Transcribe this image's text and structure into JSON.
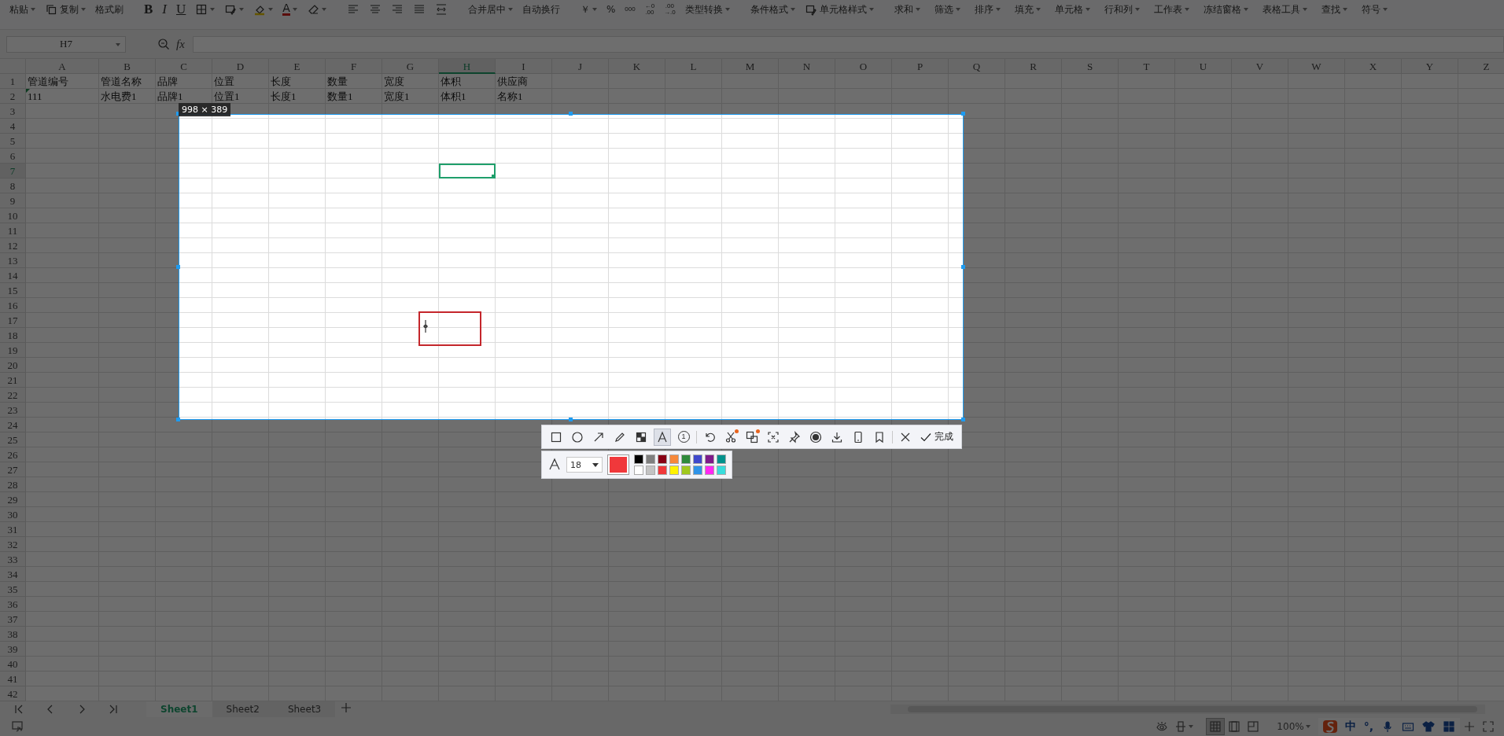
{
  "ribbon": {
    "clipboard": [
      {
        "label": "粘贴",
        "dropdown": true
      },
      {
        "label": "复制",
        "dropdown": true
      },
      {
        "label": "格式刷",
        "dropdown": false
      }
    ],
    "font_styles": [
      "B",
      "I",
      "U"
    ],
    "font_color": "A",
    "alignment": [
      {
        "label": "合并居中",
        "dropdown": true
      },
      {
        "label": "自动换行",
        "dropdown": false
      }
    ],
    "number": {
      "currency": "￥",
      "percent": "%",
      "thousands": "000",
      "decimal_increase": [
        "←0",
        ".00"
      ],
      "decimal_decrease": [
        ".00",
        "→.0"
      ],
      "type_convert": "类型转换"
    },
    "styles": [
      {
        "label": "条件格式",
        "dropdown": true
      },
      {
        "label": "单元格样式",
        "dropdown": true
      }
    ],
    "commands": [
      {
        "label": "求和",
        "dropdown": true
      },
      {
        "label": "筛选",
        "dropdown": true
      },
      {
        "label": "排序",
        "dropdown": true
      },
      {
        "label": "填充",
        "dropdown": true
      },
      {
        "label": "单元格",
        "dropdown": true
      },
      {
        "label": "行和列",
        "dropdown": true
      },
      {
        "label": "工作表",
        "dropdown": true
      },
      {
        "label": "冻结窗格",
        "dropdown": true
      },
      {
        "label": "表格工具",
        "dropdown": true
      },
      {
        "label": "查找",
        "dropdown": true
      },
      {
        "label": "符号",
        "dropdown": true
      }
    ]
  },
  "formula_bar": {
    "cell_reference": "H7",
    "function_label": "fx"
  },
  "sheet": {
    "columns": [
      {
        "label": "A",
        "selected": false
      },
      {
        "label": "B",
        "selected": false
      },
      {
        "label": "C",
        "selected": false
      },
      {
        "label": "D",
        "selected": false
      },
      {
        "label": "E",
        "selected": false
      },
      {
        "label": "F",
        "selected": false
      },
      {
        "label": "G",
        "selected": false
      },
      {
        "label": "H",
        "selected": true
      },
      {
        "label": "I",
        "selected": false
      },
      {
        "label": "J",
        "selected": false
      },
      {
        "label": "K",
        "selected": false
      },
      {
        "label": "L",
        "selected": false
      },
      {
        "label": "M",
        "selected": false
      },
      {
        "label": "N",
        "selected": false
      },
      {
        "label": "O",
        "selected": false
      },
      {
        "label": "P",
        "selected": false
      },
      {
        "label": "Q",
        "selected": false
      },
      {
        "label": "R",
        "selected": false
      },
      {
        "label": "S",
        "selected": false
      },
      {
        "label": "T",
        "selected": false
      },
      {
        "label": "U",
        "selected": false
      },
      {
        "label": "V",
        "selected": false
      },
      {
        "label": "W",
        "selected": false
      },
      {
        "label": "X",
        "selected": false
      },
      {
        "label": "Y",
        "selected": false
      },
      {
        "label": "Z",
        "selected": false
      }
    ],
    "rows": [
      {
        "label": "1",
        "selected": false
      },
      {
        "label": "2",
        "selected": false
      },
      {
        "label": "3",
        "selected": false
      },
      {
        "label": "4",
        "selected": false
      },
      {
        "label": "5",
        "selected": false
      },
      {
        "label": "6",
        "selected": false
      },
      {
        "label": "7",
        "selected": true
      },
      {
        "label": "8",
        "selected": false
      },
      {
        "label": "9",
        "selected": false
      },
      {
        "label": "10",
        "selected": false
      },
      {
        "label": "11",
        "selected": false
      },
      {
        "label": "12",
        "selected": false
      },
      {
        "label": "13",
        "selected": false
      },
      {
        "label": "14",
        "selected": false
      },
      {
        "label": "15",
        "selected": false
      },
      {
        "label": "16",
        "selected": false
      },
      {
        "label": "17",
        "selected": false
      },
      {
        "label": "18",
        "selected": false
      },
      {
        "label": "19",
        "selected": false
      },
      {
        "label": "20",
        "selected": false
      },
      {
        "label": "21",
        "selected": false
      },
      {
        "label": "22",
        "selected": false
      },
      {
        "label": "23",
        "selected": false
      },
      {
        "label": "24",
        "selected": false
      },
      {
        "label": "25",
        "selected": false
      },
      {
        "label": "26",
        "selected": false
      },
      {
        "label": "27",
        "selected": false
      },
      {
        "label": "28",
        "selected": false
      },
      {
        "label": "29",
        "selected": false
      },
      {
        "label": "30",
        "selected": false
      },
      {
        "label": "31",
        "selected": false
      },
      {
        "label": "32",
        "selected": false
      },
      {
        "label": "33",
        "selected": false
      },
      {
        "label": "34",
        "selected": false
      },
      {
        "label": "35",
        "selected": false
      },
      {
        "label": "36",
        "selected": false
      },
      {
        "label": "37",
        "selected": false
      },
      {
        "label": "38",
        "selected": false
      },
      {
        "label": "39",
        "selected": false
      },
      {
        "label": "40",
        "selected": false
      },
      {
        "label": "41",
        "selected": false
      },
      {
        "label": "42",
        "selected": false
      }
    ],
    "cells": [
      [
        "管道编号",
        "管道名称",
        "品牌",
        "位置",
        "长度",
        "数量",
        "宽度",
        "体积",
        "供应商"
      ],
      [
        "111",
        "水电费1",
        "品牌1",
        "位置1",
        "长度1",
        "数量1",
        "宽度1",
        "体积1",
        "名称1"
      ]
    ]
  },
  "sheet_tabs": [
    {
      "label": "Sheet1",
      "selected": true
    },
    {
      "label": "Sheet2",
      "selected": false
    },
    {
      "label": "Sheet3",
      "selected": false
    }
  ],
  "status_bar": {
    "views": [
      {
        "selected": true
      },
      {
        "selected": false
      },
      {
        "selected": false
      }
    ],
    "zoom": "100%",
    "ime": [
      "中",
      "°,"
    ]
  },
  "capture": {
    "size_label": "998 × 389",
    "tools": [
      {
        "selected": false,
        "dot": false
      },
      {
        "selected": false,
        "dot": false
      },
      {
        "selected": false,
        "dot": false
      },
      {
        "selected": false,
        "dot": false
      },
      {
        "selected": false,
        "dot": false
      },
      {
        "selected": true,
        "dot": false
      },
      {
        "selected": false,
        "dot": false,
        "label": "1"
      },
      {
        "selected": false,
        "dot": false
      },
      {
        "selected": false,
        "dot": true
      },
      {
        "selected": false,
        "dot": true
      },
      {
        "selected": false,
        "dot": false
      },
      {
        "selected": false,
        "dot": false
      },
      {
        "selected": false,
        "dot": false
      },
      {
        "selected": false,
        "dot": false
      },
      {
        "selected": false,
        "dot": false
      },
      {
        "selected": false,
        "dot": false
      },
      {
        "selected": false,
        "dot": false
      }
    ],
    "done_label": "完成",
    "font_size": "18",
    "palette": [
      {
        "color": "#000000",
        "selected": false
      },
      {
        "color": "#7f7f7f",
        "selected": false
      },
      {
        "color": "#880015",
        "selected": false
      },
      {
        "color": "#f7883a",
        "selected": false
      },
      {
        "color": "#2f8a3b",
        "selected": false
      },
      {
        "color": "#3f48cc",
        "selected": false
      },
      {
        "color": "#7e1a8a",
        "selected": false
      },
      {
        "color": "#00918c",
        "selected": false
      },
      {
        "color": "#ffffff",
        "selected": false
      },
      {
        "color": "#c3c3c3",
        "selected": false
      },
      {
        "color": "#f0383b",
        "selected": true
      },
      {
        "color": "#fff200",
        "selected": false
      },
      {
        "color": "#a0c81e",
        "selected": false
      },
      {
        "color": "#2f93e8",
        "selected": false
      },
      {
        "color": "#ff28f2",
        "selected": false
      },
      {
        "color": "#38dcdc",
        "selected": false
      }
    ]
  }
}
